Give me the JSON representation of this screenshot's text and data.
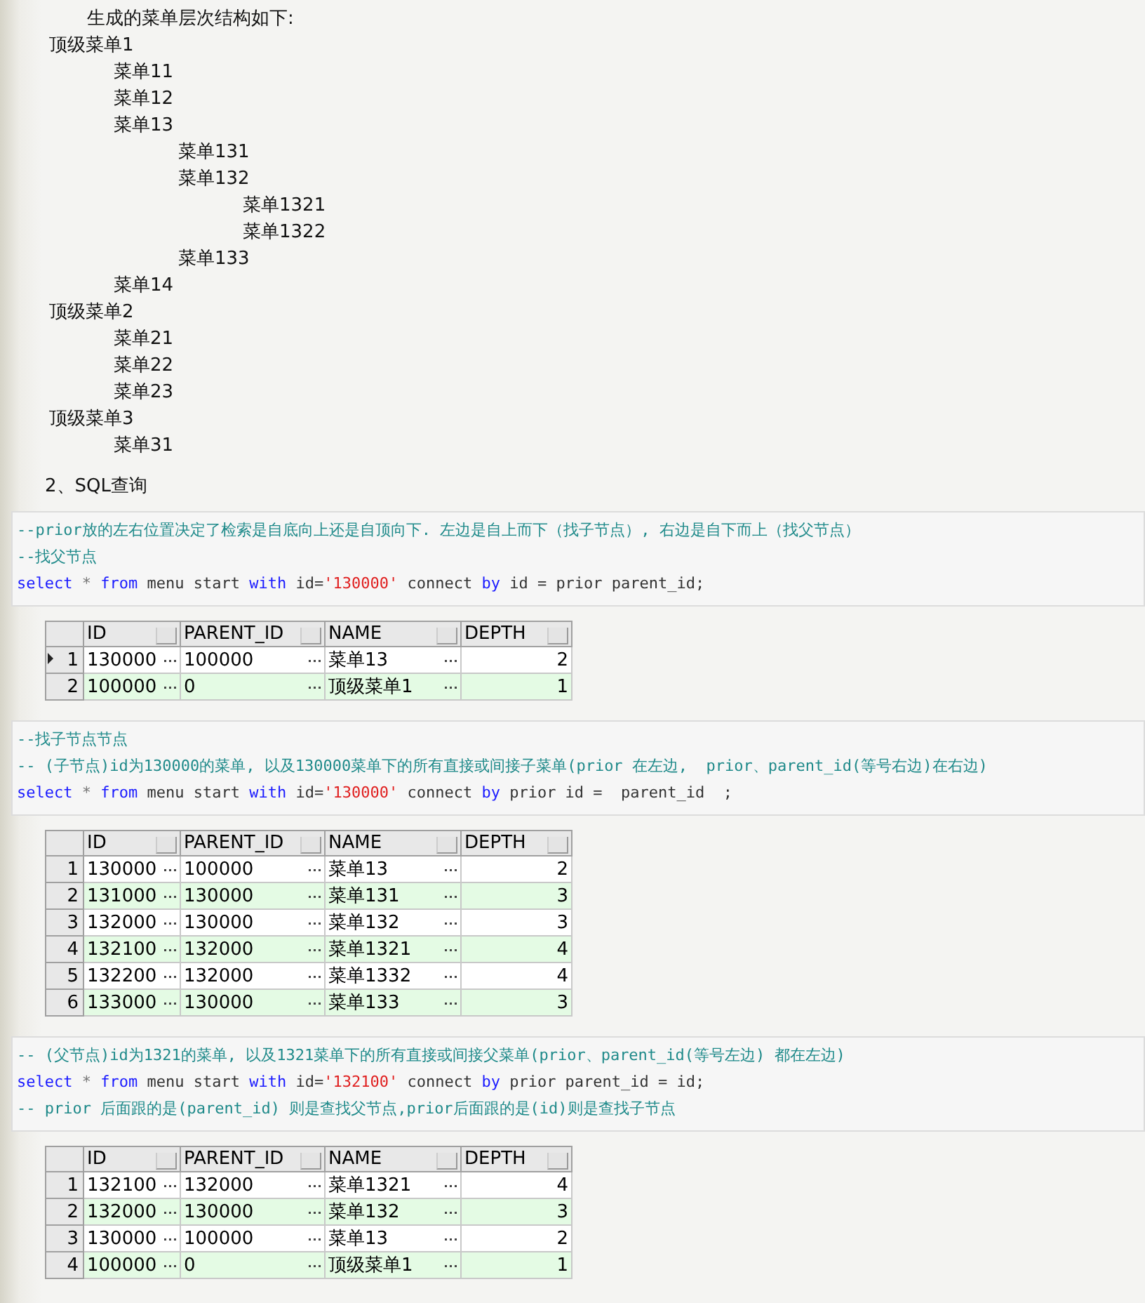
{
  "intro": "生成的菜单层次结构如下:",
  "tree": [
    {
      "label": "顶级菜单1",
      "children": [
        {
          "label": "菜单11"
        },
        {
          "label": "菜单12"
        },
        {
          "label": "菜单13",
          "children": [
            {
              "label": "菜单131"
            },
            {
              "label": "菜单132",
              "children": [
                {
                  "label": "菜单1321"
                },
                {
                  "label": "菜单1322"
                }
              ]
            },
            {
              "label": "菜单133"
            }
          ]
        },
        {
          "label": "菜单14"
        }
      ]
    },
    {
      "label": "顶级菜单2",
      "children": [
        {
          "label": "菜单21"
        },
        {
          "label": "菜单22"
        },
        {
          "label": "菜单23"
        }
      ]
    },
    {
      "label": "顶级菜单3",
      "children": [
        {
          "label": "菜单31"
        }
      ]
    }
  ],
  "heading": "2、SQL查询",
  "sections": [
    {
      "code_lines": [
        [
          {
            "kind": "comment",
            "text": "--prior放的左右位置决定了检索是自底向上还是自顶向下. 左边是自上而下（找子节点）, 右边是自下而上（找父节点）"
          }
        ],
        [
          {
            "kind": "comment",
            "text": "--找父节点"
          }
        ],
        [
          {
            "kind": "keyword",
            "text": "select"
          },
          {
            "kind": "operator",
            "text": " * "
          },
          {
            "kind": "keyword",
            "text": "from"
          },
          {
            "kind": "plain",
            "text": " menu start "
          },
          {
            "kind": "keyword",
            "text": "with"
          },
          {
            "kind": "plain",
            "text": " id="
          },
          {
            "kind": "string",
            "text": "'130000'"
          },
          {
            "kind": "plain",
            "text": " connect "
          },
          {
            "kind": "keyword",
            "text": "by"
          },
          {
            "kind": "plain",
            "text": " id = prior parent_id;"
          }
        ]
      ],
      "result": {
        "columns": [
          "ID",
          "PARENT_ID",
          "NAME",
          "DEPTH"
        ],
        "rows": [
          {
            "number": "1",
            "current": true,
            "cells": [
              "130000",
              "100000",
              "菜单13",
              "2"
            ]
          },
          {
            "number": "2",
            "current": false,
            "cells": [
              "100000",
              "0",
              "顶级菜单1",
              "1"
            ]
          }
        ]
      }
    },
    {
      "code_lines": [
        [
          {
            "kind": "comment",
            "text": "--找子节点节点"
          }
        ],
        [
          {
            "kind": "comment",
            "text": "-- (子节点)id为130000的菜单, 以及130000菜单下的所有直接或间接子菜单(prior 在左边,  prior、parent_id(等号右边)在右边)"
          }
        ],
        [
          {
            "kind": "keyword",
            "text": "select"
          },
          {
            "kind": "operator",
            "text": " * "
          },
          {
            "kind": "keyword",
            "text": "from"
          },
          {
            "kind": "plain",
            "text": " menu start "
          },
          {
            "kind": "keyword",
            "text": "with"
          },
          {
            "kind": "plain",
            "text": " id="
          },
          {
            "kind": "string",
            "text": "'130000'"
          },
          {
            "kind": "plain",
            "text": " connect "
          },
          {
            "kind": "keyword",
            "text": "by"
          },
          {
            "kind": "plain",
            "text": " prior id =  parent_id  ;"
          }
        ]
      ],
      "result": {
        "columns": [
          "ID",
          "PARENT_ID",
          "NAME",
          "DEPTH"
        ],
        "rows": [
          {
            "number": "1",
            "current": false,
            "cells": [
              "130000",
              "100000",
              "菜单13",
              "2"
            ]
          },
          {
            "number": "2",
            "current": false,
            "cells": [
              "131000",
              "130000",
              "菜单131",
              "3"
            ]
          },
          {
            "number": "3",
            "current": false,
            "cells": [
              "132000",
              "130000",
              "菜单132",
              "3"
            ]
          },
          {
            "number": "4",
            "current": false,
            "cells": [
              "132100",
              "132000",
              "菜单1321",
              "4"
            ]
          },
          {
            "number": "5",
            "current": false,
            "cells": [
              "132200",
              "132000",
              "菜单1332",
              "4"
            ]
          },
          {
            "number": "6",
            "current": false,
            "cells": [
              "133000",
              "130000",
              "菜单133",
              "3"
            ]
          }
        ]
      }
    },
    {
      "code_lines": [
        [
          {
            "kind": "comment",
            "text": "-- (父节点)id为1321的菜单, 以及1321菜单下的所有直接或间接父菜单(prior、parent_id(等号左边) 都在左边)"
          }
        ],
        [
          {
            "kind": "keyword",
            "text": "select"
          },
          {
            "kind": "operator",
            "text": " * "
          },
          {
            "kind": "keyword",
            "text": "from"
          },
          {
            "kind": "plain",
            "text": " menu start "
          },
          {
            "kind": "keyword",
            "text": "with"
          },
          {
            "kind": "plain",
            "text": " id="
          },
          {
            "kind": "string",
            "text": "'132100'"
          },
          {
            "kind": "plain",
            "text": " connect "
          },
          {
            "kind": "keyword",
            "text": "by"
          },
          {
            "kind": "plain",
            "text": " prior parent_id = id;"
          }
        ],
        [
          {
            "kind": "comment",
            "text": "-- prior 后面跟的是(parent_id) 则是查找父节点,prior后面跟的是(id)则是查找子节点"
          }
        ]
      ],
      "result": {
        "columns": [
          "ID",
          "PARENT_ID",
          "NAME",
          "DEPTH"
        ],
        "rows": [
          {
            "number": "1",
            "current": false,
            "cells": [
              "132100",
              "132000",
              "菜单1321",
              "4"
            ]
          },
          {
            "number": "2",
            "current": false,
            "cells": [
              "132000",
              "130000",
              "菜单132",
              "3"
            ]
          },
          {
            "number": "3",
            "current": false,
            "cells": [
              "130000",
              "100000",
              "菜单13",
              "2"
            ]
          },
          {
            "number": "4",
            "current": false,
            "cells": [
              "100000",
              "0",
              "顶级菜单1",
              "1"
            ]
          }
        ]
      }
    }
  ]
}
